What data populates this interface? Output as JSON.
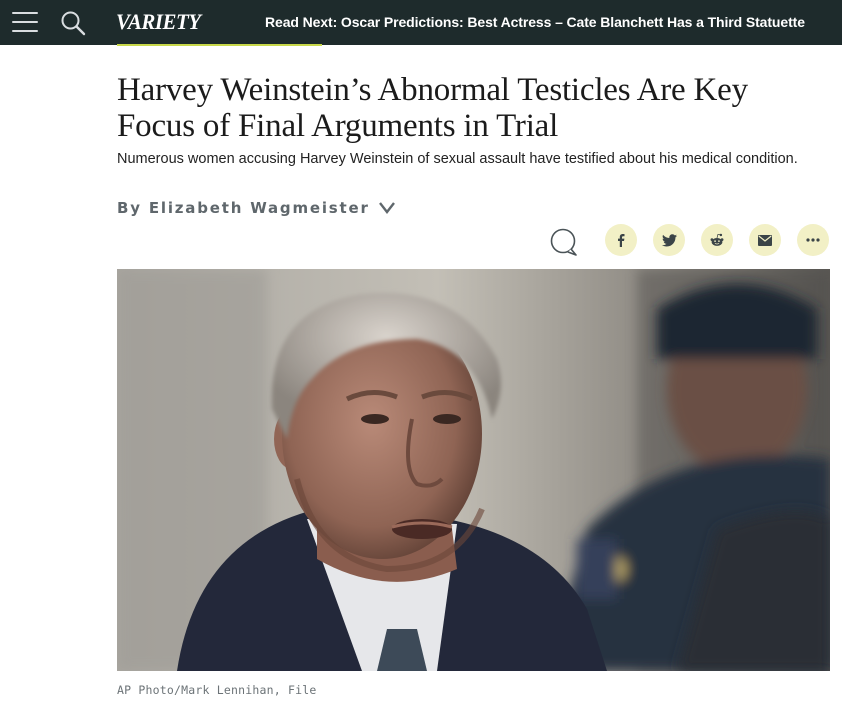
{
  "nav": {
    "logo_text": "VARIETY",
    "read_next": "Read Next: Oscar Predictions: Best Actress – Cate Blanchett Has a Third Statuette",
    "accent_color": "#c8d84a",
    "bar_color": "#1e2b2c",
    "menu_icon": "hamburger-menu-icon",
    "search_icon": "search-icon"
  },
  "article": {
    "headline": "Harvey Weinstein’s Abnormal Testicles Are Key Focus of Final Arguments in Trial",
    "dek": "Numerous women accusing Harvey Weinstein of sexual assault have testified about his medical condition.",
    "byline": "By Elizabeth Wagmeister",
    "byline_icon": "chevron-down-icon"
  },
  "share": {
    "comment_icon": "comment-bubble-icon",
    "button_color": "#f2f0c6",
    "buttons": [
      {
        "name": "facebook",
        "icon": "facebook-icon"
      },
      {
        "name": "twitter",
        "icon": "twitter-icon"
      },
      {
        "name": "reddit",
        "icon": "reddit-icon"
      },
      {
        "name": "email",
        "icon": "email-icon"
      },
      {
        "name": "more",
        "icon": "more-dots-icon"
      }
    ]
  },
  "photo": {
    "caption": "AP Photo/Mark Lennihan, File"
  }
}
